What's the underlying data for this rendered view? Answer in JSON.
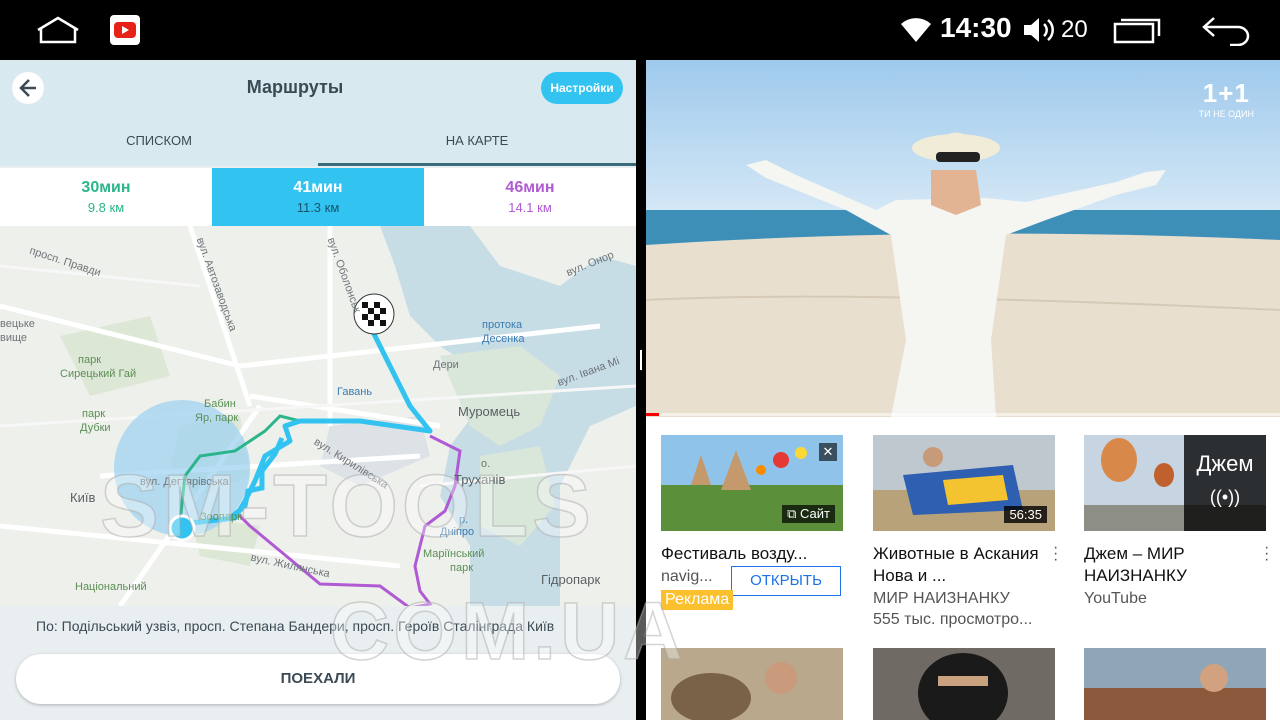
{
  "status_bar": {
    "time": "14:30",
    "volume": "20",
    "icons": [
      "home-icon",
      "youtube-icon",
      "wifi-icon",
      "volume-icon",
      "recent-apps-icon",
      "back-icon"
    ]
  },
  "nav": {
    "title": "Маршруты",
    "settings_label": "Настройки",
    "tabs": [
      {
        "label": "СПИСКОМ",
        "active": false
      },
      {
        "label": "НА КАРТЕ",
        "active": true
      }
    ],
    "routes": [
      {
        "time": "30мин",
        "distance": "9.8 км",
        "color": "#2bb58a",
        "selected": false
      },
      {
        "time": "41мин",
        "distance": "11.3 км",
        "color": "#ffffff",
        "selected": true
      },
      {
        "time": "46мин",
        "distance": "14.1 км",
        "color": "#b05ad4",
        "selected": false
      }
    ],
    "map_labels": {
      "obolonsky": "вул. Оболонськ",
      "avtozavodska": "вул. Автозаводська",
      "pravdy": "просп. Правди",
      "onore": "вул. Онор",
      "protoka": "протока",
      "desenka": "Десенка",
      "ivana_mi": "вул. Івана Мі",
      "vetseyka": "вецьке",
      "vyshche": "вище",
      "syretskyi_park": "парк",
      "syretskyi_gai": "Сирецький Гай",
      "deri": "Дери",
      "havan": "Гавань",
      "muromets": "Муромець",
      "babyn": "Бабин",
      "yar_park": "Яр, парк",
      "park": "парк",
      "dubky": "Дубки",
      "kyrylivska": "вул. Кирилівська",
      "o": "о.",
      "trukhaniv": "Труханів",
      "degtiarivska": "вул. Дегтярівська",
      "kyiv": "Київ",
      "zoopark": "Зоопарк",
      "r": "р.",
      "dnipro": "Дніпро",
      "marinsky": "Маріїнський",
      "park2": "парк",
      "zhylianska": "вул. Жилянська",
      "hidropark": "Гідропарк",
      "natsionalnyi": "Національний"
    },
    "via_text": "По: Подільський узвіз, просп. Степана Бандери, просп. Героїв Сталінграда Київ",
    "go_label": "ПОЕХАЛИ"
  },
  "video": {
    "channel_name": "1+1",
    "channel_slogan": "ТИ НЕ ОДИН",
    "progress": 0.02
  },
  "recommendations": [
    {
      "title": "Фестиваль возду...",
      "meta": "navig...",
      "open_label": "ОТКРЫТЬ",
      "ad_label": "Реклама",
      "site_label": "Сайт",
      "is_ad": true
    },
    {
      "title": "Животные в Аскания Нова и ...",
      "meta_line1": "МИР НАИЗНАНКУ",
      "meta_line2": "555 тыс. просмотро...",
      "duration": "56:35"
    },
    {
      "title": "Джем – МИР НАИЗНАНКУ",
      "meta_line1": "YouTube",
      "live_label": "Джем"
    }
  ],
  "watermark": {
    "line1": "SM-TOOLS",
    "line2": "COM.UA"
  }
}
